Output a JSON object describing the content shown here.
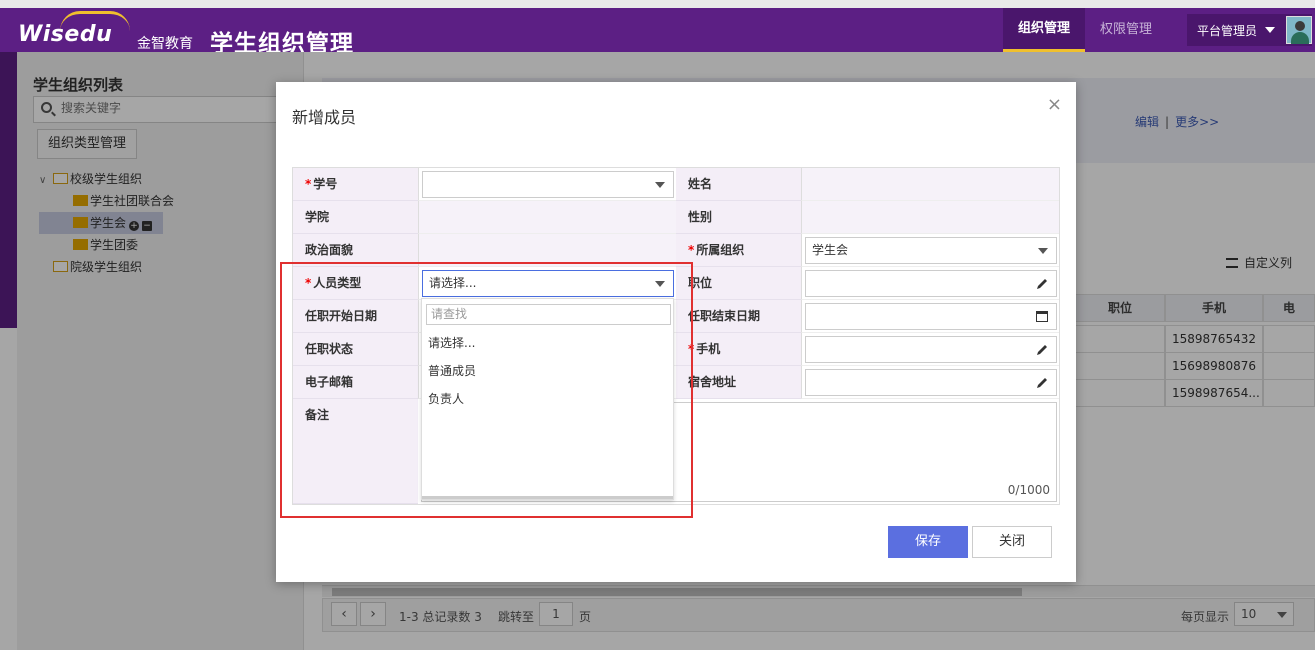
{
  "header": {
    "logo": "Wisedu",
    "logo_cn": "金智教育",
    "app_title": "学生组织管理",
    "tabs": [
      {
        "label": "组织管理",
        "active": true
      },
      {
        "label": "权限管理",
        "active": false
      }
    ],
    "user": "平台管理员",
    "brand_color": "#5c1f84",
    "accent_color": "#f0c02d"
  },
  "sidebar": {
    "title": "学生组织列表",
    "search_placeholder": "搜索关键字",
    "type_button": "组织类型管理",
    "tree": [
      {
        "label": "校级学生组织",
        "level": 0,
        "expanded": true
      },
      {
        "label": "学生社团联合会",
        "level": 1
      },
      {
        "label": "学生会",
        "level": 1,
        "selected": true
      },
      {
        "label": "学生团委",
        "level": 1
      },
      {
        "label": "院级学生组织",
        "level": 0
      }
    ]
  },
  "main": {
    "links": {
      "edit": "编辑",
      "sep": "|",
      "more": "更多>>"
    },
    "custom_columns": "自定义列",
    "table": {
      "headers": [
        "职位",
        "手机",
        "电"
      ],
      "phones": [
        "15898765432",
        "15698980876",
        "1598987654..."
      ]
    },
    "pager": {
      "summary": "1-3 总记录数 3",
      "jump_label": "跳转至",
      "page": "1",
      "page_unit": "页",
      "per_page_label": "每页显示",
      "per_page": "10"
    }
  },
  "modal": {
    "title": "新增成员",
    "close": "×",
    "labels": {
      "student_id": "学号",
      "name": "姓名",
      "college": "学院",
      "gender": "性别",
      "political": "政治面貌",
      "org": "所属组织",
      "member_type": "人员类型",
      "position": "职位",
      "start_date": "任职开始日期",
      "end_date": "任职结束日期",
      "status": "任职状态",
      "phone": "手机",
      "email": "电子邮箱",
      "dorm": "宿舍地址",
      "remark": "备注"
    },
    "values": {
      "org": "学生会",
      "member_type": "请选择..."
    },
    "remark_counter": "0/1000",
    "dropdown": {
      "search_placeholder": "请查找",
      "options": [
        "请选择...",
        "普通成员",
        "负责人"
      ]
    },
    "buttons": {
      "save": "保存",
      "close": "关闭"
    },
    "highlight_color": "#e03030"
  }
}
